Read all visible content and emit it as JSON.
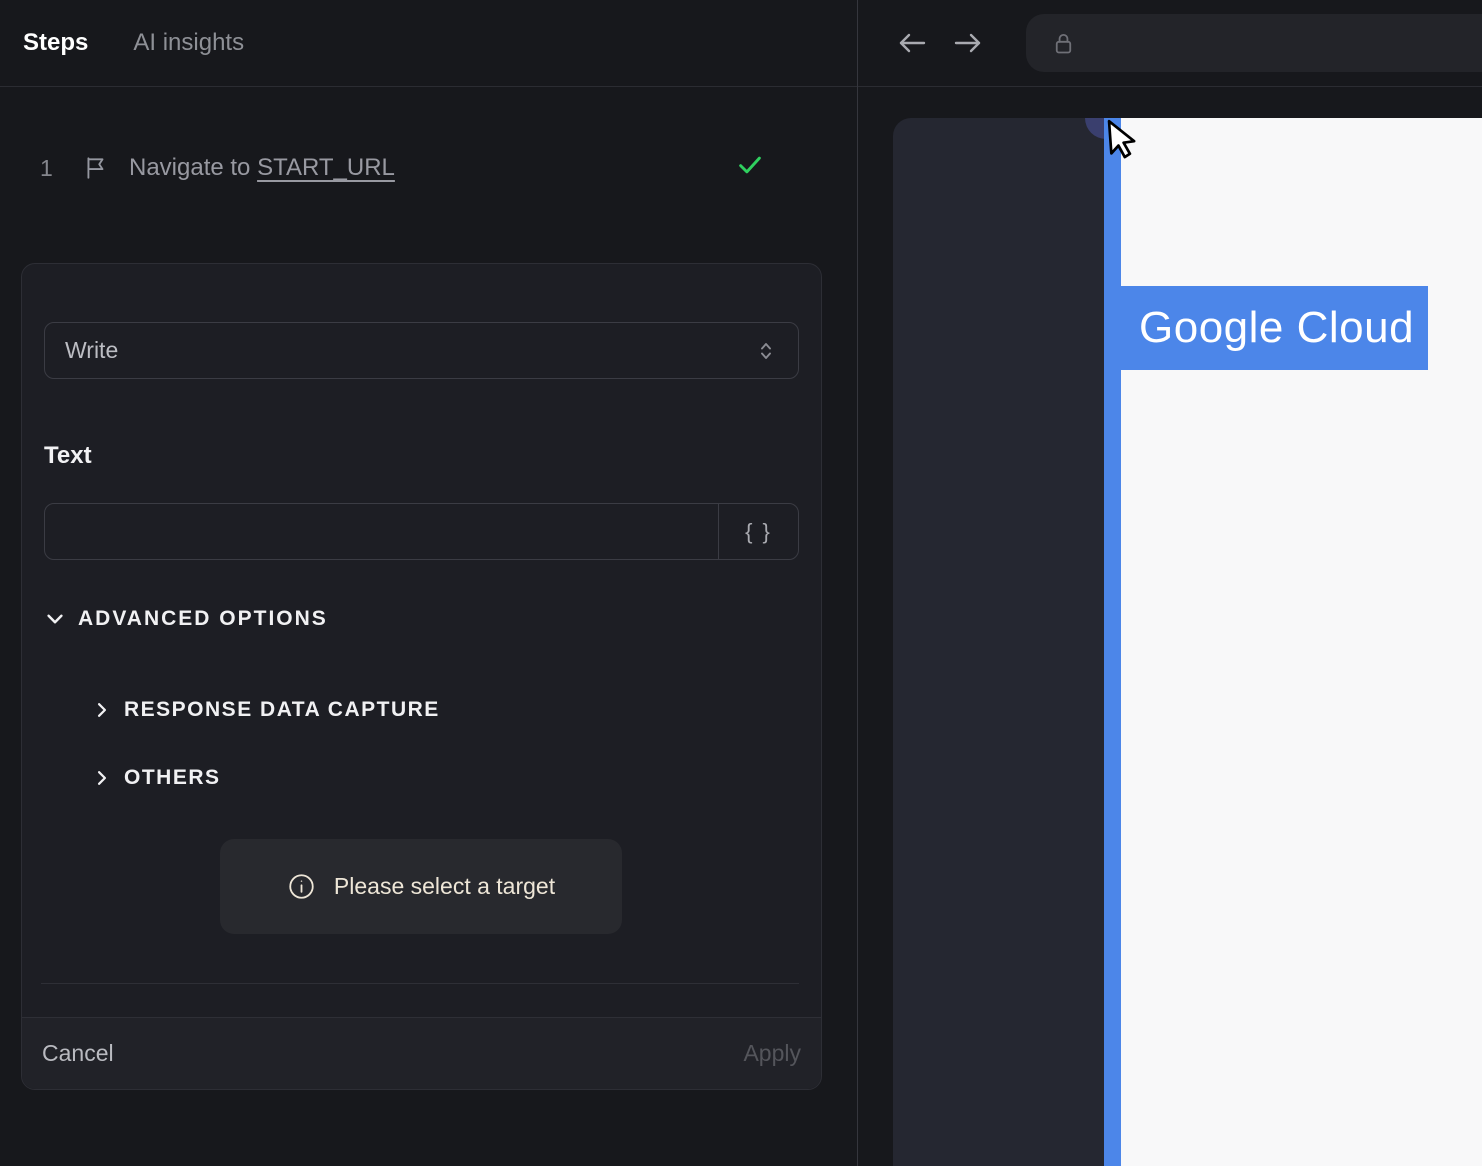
{
  "left_panel": {
    "tabs": [
      {
        "label": "Steps"
      },
      {
        "label": "AI insights"
      }
    ],
    "step": {
      "number": "1",
      "action": "Navigate to",
      "target": "START_URL",
      "status": "success"
    },
    "editor": {
      "action_select": {
        "value": "Write"
      },
      "text_field": {
        "label": "Text",
        "value": "",
        "placeholder": ""
      },
      "variable_button_label": "{ }",
      "advanced_options_label": "ADVANCED OPTIONS",
      "sections": [
        {
          "label": "RESPONSE DATA CAPTURE"
        },
        {
          "label": "OTHERS"
        }
      ],
      "target_hint": "Please select a target",
      "cancel_label": "Cancel",
      "apply_label": "Apply"
    }
  },
  "browser": {
    "url_value": "",
    "page": {
      "banner_label": "Google Cloud"
    }
  },
  "colors": {
    "accent_blue": "#4c86e9",
    "success_green": "#2fd05f",
    "hint_cream": "#eee6d7",
    "panel_dark": "#17181c",
    "page_white": "#f8f8f9",
    "highlight_navy": "#3a3f6e"
  }
}
